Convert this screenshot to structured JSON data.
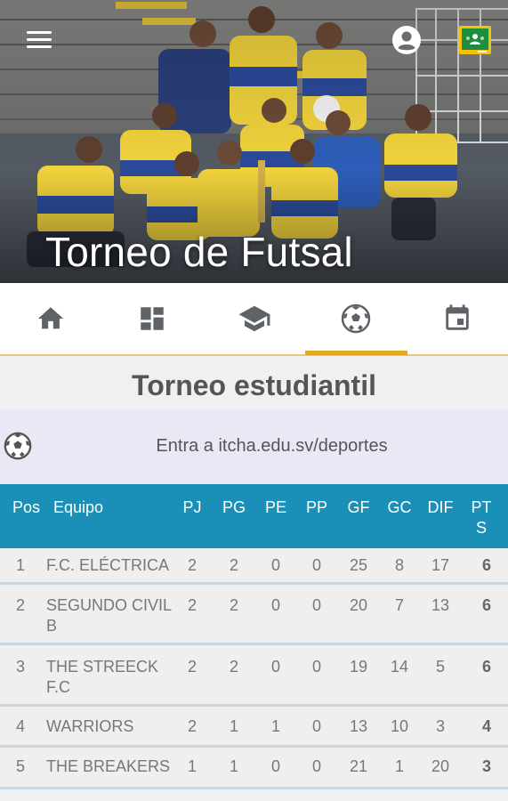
{
  "hero": {
    "title": "Torneo de Futsal"
  },
  "nav": {
    "active_tab": "futbol",
    "accent_color": "#e0a91e",
    "tabs": [
      {
        "key": "home",
        "icon": "home-icon"
      },
      {
        "key": "dashboard",
        "icon": "dashboard-icon"
      },
      {
        "key": "school",
        "icon": "graduation-cap-icon"
      },
      {
        "key": "futbol",
        "icon": "soccer-ball-icon"
      },
      {
        "key": "calendar",
        "icon": "calendar-icon"
      }
    ]
  },
  "main": {
    "title": "Torneo estudiantil",
    "info_text": "Entra a itcha.edu.sv/deportes"
  },
  "table": {
    "header_color": "#1a8fb7",
    "headers": {
      "pos": "Pos",
      "equipo": "Equipo",
      "pj": "PJ",
      "pg": "PG",
      "pe": "PE",
      "pp": "PP",
      "gf": "GF",
      "gc": "GC",
      "dif": "DIF",
      "pts_1": "PT",
      "pts_2": "S"
    },
    "rows": [
      {
        "pos": "1",
        "equipo_1": "F.C. ELÉCTRICA",
        "equipo_2": "",
        "pj": "2",
        "pg": "2",
        "pe": "0",
        "pp": "0",
        "gf": "25",
        "gc": "8",
        "dif": "17",
        "pts": "6"
      },
      {
        "pos": "2",
        "equipo_1": "SEGUNDO CIVIL",
        "equipo_2": "B",
        "pj": "2",
        "pg": "2",
        "pe": "0",
        "pp": "0",
        "gf": "20",
        "gc": "7",
        "dif": "13",
        "pts": "6"
      },
      {
        "pos": "3",
        "equipo_1": "THE STREECK",
        "equipo_2": "F.C",
        "pj": "2",
        "pg": "2",
        "pe": "0",
        "pp": "0",
        "gf": "19",
        "gc": "14",
        "dif": "5",
        "pts": "6"
      },
      {
        "pos": "4",
        "equipo_1": "WARRIORS",
        "equipo_2": "",
        "pj": "2",
        "pg": "1",
        "pe": "1",
        "pp": "0",
        "gf": "13",
        "gc": "10",
        "dif": "3",
        "pts": "4"
      },
      {
        "pos": "5",
        "equipo_1": "THE BREAKERS",
        "equipo_2": "",
        "pj": "1",
        "pg": "1",
        "pe": "0",
        "pp": "0",
        "gf": "21",
        "gc": "1",
        "dif": "20",
        "pts": "3"
      }
    ]
  }
}
